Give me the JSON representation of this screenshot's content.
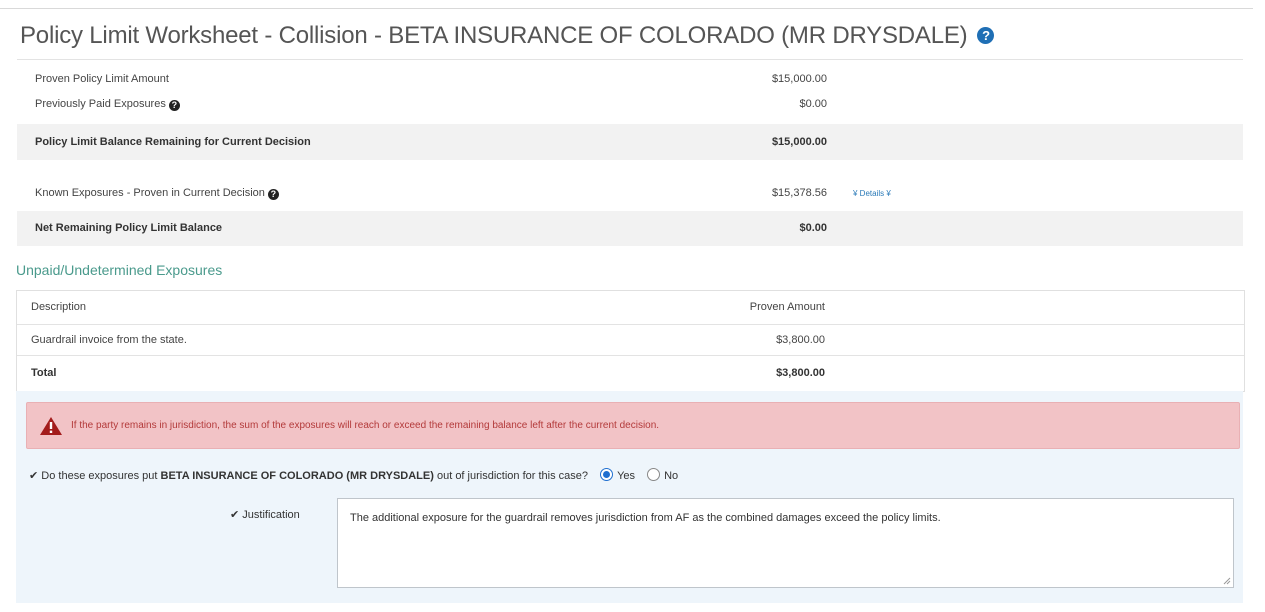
{
  "worksheet": {
    "title": "Policy Limit Worksheet - Collision - BETA INSURANCE OF COLORADO (MR DRYSDALE)",
    "help_icon": "question-circle-icon",
    "rows": {
      "proven_policy_limit": {
        "label": "Proven Policy Limit Amount",
        "amount": "$15,000.00"
      },
      "previously_paid": {
        "label": "Previously Paid Exposures",
        "amount": "$0.00"
      },
      "balance_remaining": {
        "label": "Policy Limit Balance Remaining for Current Decision",
        "amount": "$15,000.00"
      },
      "known_exposures": {
        "label": "Known Exposures - Proven in Current Decision",
        "amount": "$15,378.56",
        "details_link": "¥ Details ¥"
      },
      "net_remaining": {
        "label": "Net Remaining Policy Limit Balance",
        "amount": "$0.00"
      }
    }
  },
  "unpaid_section": {
    "title": "Unpaid/Undetermined Exposures",
    "columns": {
      "description": "Description",
      "amount": "Proven Amount"
    },
    "rows": [
      {
        "description": "Guardrail invoice from the state.",
        "amount": "$3,800.00"
      }
    ],
    "total": {
      "label": "Total",
      "amount": "$3,800.00"
    }
  },
  "alert": {
    "icon": "warning-triangle-icon",
    "text": "If the party remains in jurisdiction, the sum of the exposures will reach or exceed the remaining balance left after the current decision.",
    "color": "#f2c3c6"
  },
  "jurisdiction": {
    "question_prefix": "Do these exposures put",
    "party": "BETA INSURANCE OF COLORADO (MR DRYSDALE)",
    "question_suffix": "out of jurisdiction for this case?",
    "options": {
      "yes": "Yes",
      "no": "No"
    },
    "selected": "Yes"
  },
  "justification": {
    "label": "Justification",
    "value": "The additional exposure for the guardrail removes jurisdiction from AF as the combined damages exceed the policy limits."
  },
  "colors": {
    "accent": "#1f6fb5",
    "section_title": "#4a9a8c",
    "alert_text": "#b33a3a",
    "panel_bg": "#eef5fb"
  }
}
